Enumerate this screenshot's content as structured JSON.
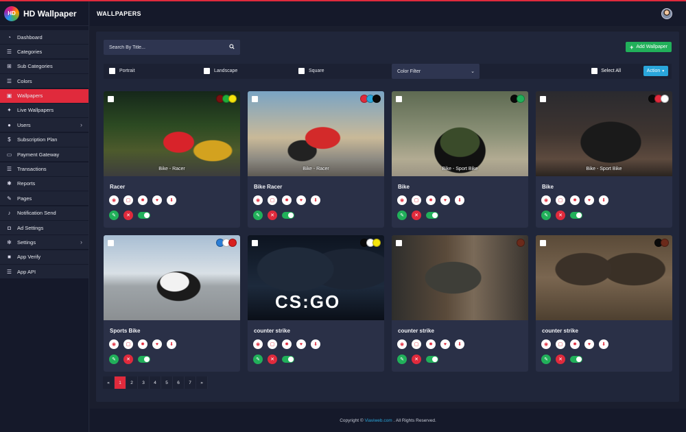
{
  "app": {
    "logo_abbr": "HD",
    "title": "HD Wallpaper",
    "page_title": "WALLPAPERS"
  },
  "sidebar": {
    "items": [
      {
        "label": "Dashboard",
        "icon": "dashboard-icon"
      },
      {
        "label": "Categories",
        "icon": "list-icon"
      },
      {
        "label": "Sub Categories",
        "icon": "sitemap-icon"
      },
      {
        "label": "Colors",
        "icon": "list-icon"
      },
      {
        "label": "Wallpapers",
        "icon": "image-icon",
        "active": true
      },
      {
        "label": "Live Wallpapers",
        "icon": "magic-icon"
      },
      {
        "label": "Users",
        "icon": "users-icon",
        "expandable": true
      },
      {
        "label": "Subscription Plan",
        "icon": "dollar-icon"
      },
      {
        "label": "Payment Gateway",
        "icon": "credit-card-icon"
      },
      {
        "label": "Transactions",
        "icon": "list-icon"
      },
      {
        "label": "Reports",
        "icon": "bug-icon"
      },
      {
        "label": "Pages",
        "icon": "edit-icon"
      },
      {
        "label": "Notification Send",
        "icon": "bell-icon"
      },
      {
        "label": "Ad Settings",
        "icon": "ad-icon"
      },
      {
        "label": "Settings",
        "icon": "gear-icon",
        "expandable": true
      },
      {
        "label": "App Verify",
        "icon": "lock-icon"
      },
      {
        "label": "App API",
        "icon": "list-icon"
      }
    ]
  },
  "toolbar": {
    "search_placeholder": "Search By Title...",
    "add_label": "Add Wallpaper"
  },
  "filters": {
    "portrait": "Portrait",
    "landscape": "Landscape",
    "square": "Square",
    "color_filter": "Color Filter",
    "select_all": "Select All",
    "action": "Action"
  },
  "cards": [
    {
      "title": "Racer",
      "thumb_label": "Bike - Racer",
      "colors": [
        "#7a1010",
        "#1fae3a",
        "#f5e50c"
      ]
    },
    {
      "title": "Bike Racer",
      "thumb_label": "Bike - Racer",
      "colors": [
        "#e02a3c",
        "#2aa6db",
        "#0a0a0a"
      ]
    },
    {
      "title": "Bike",
      "thumb_label": "Bike - Sport Bike",
      "colors": [
        "#0a0a0a",
        "#21b05a"
      ]
    },
    {
      "title": "Bike",
      "thumb_label": "Bike - Sport Bike",
      "colors": [
        "#0a0a0a",
        "#e02a3c",
        "#ffffff"
      ]
    },
    {
      "title": "Sports Bike",
      "thumb_label": "",
      "colors": [
        "#2a7dd6",
        "#ffffff",
        "#d81f1f"
      ]
    },
    {
      "title": "counter strike",
      "thumb_label": "",
      "colors": [
        "#0a0a0a",
        "#ffffff",
        "#f5e50c"
      ]
    },
    {
      "title": "counter strike",
      "thumb_label": "",
      "colors": [
        "#6b2a1a"
      ]
    },
    {
      "title": "counter strike",
      "thumb_label": "",
      "colors": [
        "#0a0a0a",
        "#6b2a1a"
      ]
    }
  ],
  "pagination": {
    "prev": "«",
    "pages": [
      "1",
      "2",
      "3",
      "4",
      "5",
      "6",
      "7"
    ],
    "next": "»",
    "active": "1"
  },
  "footer": {
    "prefix": "Copyright ©",
    "link": "Viaviweb.com",
    "suffix": ". All Rights Reserved."
  }
}
